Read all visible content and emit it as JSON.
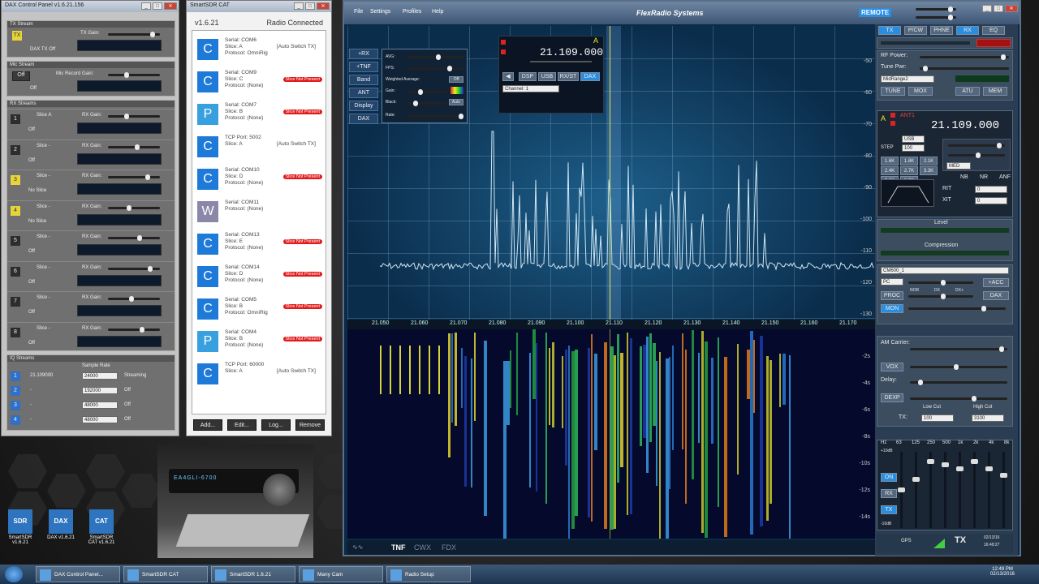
{
  "dax": {
    "title": "DAX Control Panel v1.6.21.156",
    "tx_stream": {
      "header": "TX Stream",
      "gain_label": "TX Gain:",
      "status": "DAX TX Off"
    },
    "mic_stream": {
      "header": "Mic Stream",
      "button": "Off",
      "gain_label": "Mic Record Gain:",
      "status": "Off"
    },
    "rx_header": "RX Streams",
    "rx": [
      {
        "num": "1",
        "slice": "Slice A",
        "status": "Off",
        "gain": "RX Gain:",
        "on": false
      },
      {
        "num": "2",
        "slice": "Slice -",
        "status": "Off",
        "gain": "RX Gain:",
        "on": false
      },
      {
        "num": "3",
        "slice": "Slice -",
        "status": "No Slice",
        "gain": "RX Gain:",
        "on": true
      },
      {
        "num": "4",
        "slice": "Slice -",
        "status": "No Slice",
        "gain": "RX Gain:",
        "on": true
      },
      {
        "num": "5",
        "slice": "Slice -",
        "status": "Off",
        "gain": "RX Gain:",
        "on": false
      },
      {
        "num": "6",
        "slice": "Slice -",
        "status": "Off",
        "gain": "RX Gain:",
        "on": false
      },
      {
        "num": "7",
        "slice": "Slice -",
        "status": "Off",
        "gain": "RX Gain:",
        "on": false
      },
      {
        "num": "8",
        "slice": "Slice -",
        "status": "Off",
        "gain": "RX Gain:",
        "on": false
      }
    ],
    "iq": {
      "header": "IQ Streams",
      "rate_label": "Sample Rate",
      "rows": [
        {
          "num": "1",
          "freq": "21.109000",
          "rate": "24000",
          "status": "Streaming"
        },
        {
          "num": "2",
          "freq": "-",
          "rate": "192000",
          "status": "Off"
        },
        {
          "num": "3",
          "freq": "-",
          "rate": "48000",
          "status": "Off"
        },
        {
          "num": "4",
          "freq": "-",
          "rate": "48000",
          "status": "Off"
        }
      ]
    }
  },
  "cat": {
    "title": "SmartSDR CAT",
    "version": "v1.6.21",
    "status": "Radio Connected",
    "items": [
      {
        "icon": "C",
        "name": "Serial: COM6",
        "slice": "Slice: A",
        "mode": "[Auto Switch TX]",
        "proto": "Protocol: OmniRig",
        "badge": ""
      },
      {
        "icon": "C",
        "name": "Serial: COM9",
        "slice": "Slice: C",
        "mode": "",
        "proto": "Protocol: (None)",
        "badge": "Slice Not Present"
      },
      {
        "icon": "P",
        "name": "Serial: COM7",
        "slice": "Slice: B",
        "mode": "",
        "proto": "Protocol: (None)",
        "badge": "Slice Not Present"
      },
      {
        "icon": "C",
        "name": "TCP Port: 5002",
        "slice": "Slice: A",
        "mode": "[Auto Switch TX]",
        "proto": "",
        "badge": ""
      },
      {
        "icon": "C",
        "name": "Serial: COM10",
        "slice": "Slice: D",
        "mode": "",
        "proto": "Protocol: (None)",
        "badge": "Slice Not Present"
      },
      {
        "icon": "W",
        "name": "Serial: COM11",
        "slice": "",
        "mode": "",
        "proto": "Protocol: (None)",
        "badge": ""
      },
      {
        "icon": "C",
        "name": "Serial: COM13",
        "slice": "Slice: E",
        "mode": "",
        "proto": "Protocol: (None)",
        "badge": "Slice Not Present"
      },
      {
        "icon": "C",
        "name": "Serial: COM14",
        "slice": "Slice: D",
        "mode": "",
        "proto": "Protocol: (None)",
        "badge": "Slice Not Present"
      },
      {
        "icon": "C",
        "name": "Serial: COM5",
        "slice": "Slice: B",
        "mode": "",
        "proto": "Protocol: OmniRig",
        "badge": "Slice Not Present"
      },
      {
        "icon": "P",
        "name": "Serial: COM4",
        "slice": "Slice: B",
        "mode": "",
        "proto": "Protocol: (None)",
        "badge": "Slice Not Present"
      },
      {
        "icon": "C",
        "name": "TCP Port: 60000",
        "slice": "Slice: A",
        "mode": "[Auto Switch TX]",
        "proto": "",
        "badge": ""
      }
    ],
    "buttons": [
      "Add...",
      "Edit...",
      "Log...",
      "Remove"
    ]
  },
  "sdr": {
    "menu": [
      "File",
      "Settings",
      "Profiles",
      "Help"
    ],
    "brand": "FlexRadio Systems",
    "remote": "REMOTE",
    "tabs": [
      "TX",
      "P/CW",
      "PHNE",
      "RX",
      "EQ"
    ],
    "left_buttons": [
      "+RX",
      "+TNF",
      "Band",
      "ANT",
      "Display",
      "DAX"
    ],
    "display_menu": [
      "AVG:",
      "FPS:",
      "Weighted Average:",
      "Color:",
      "Gain:",
      "Black:",
      "Rate:"
    ],
    "weighted_off": "Off",
    "black_auto": "Auto",
    "slice_freq": "21.109.000",
    "slice_letter": "A",
    "slice_tabs": [
      "DSP",
      "USB",
      "RX/ST",
      "DAX"
    ],
    "channel": "Channel: 1",
    "db_labels": [
      "-50",
      "-60",
      "-70",
      "-80",
      "-90",
      "-100",
      "-110",
      "-120",
      "-130"
    ],
    "freq_labels": [
      "21.050",
      "21.060",
      "21.070",
      "21.080",
      "21.090",
      "21.100",
      "21.110",
      "21.120",
      "21.130",
      "21.140",
      "21.150",
      "21.160",
      "21.170"
    ],
    "wf_times": [
      "-2s",
      "-4s",
      "-6s",
      "-8s",
      "-10s",
      "-12s",
      "-14s"
    ],
    "bottom": [
      "TNF",
      "CWX",
      "FDX"
    ],
    "right": {
      "rf_power": "RF Power:",
      "tune_pwr": "Tune Pwr:",
      "profile": "MidRange2",
      "tune": "TUNE",
      "mox": "MOX",
      "atu": "ATU",
      "mem": "MEM",
      "freq": "21.109.000",
      "ant": "ANT1",
      "mode": "USB",
      "step": "STEP",
      "step_val": "100",
      "filters": [
        "1.6K",
        "1.8K",
        "2.1K",
        "2.4K",
        "2.7K",
        "3.3K",
        "3.6K",
        "6.0K"
      ],
      "agc": "MED",
      "nb": "NB",
      "nr": "NR",
      "anf": "ANF",
      "rit": "RIT",
      "xit": "XIT",
      "level": "Level",
      "compression": "Compression",
      "mic_profile": "CM600_1",
      "mic": "PC",
      "acc": "+ACC",
      "proc": "PROC",
      "dax": "DAX",
      "nor": "NOR",
      "dx": "DX",
      "dxx": "DX+",
      "mon": "MON",
      "am_carrier": "AM Carrier:",
      "vox": "VOX",
      "delay": "Delay:",
      "dexp": "DEXP",
      "low_cut": "Low Cut",
      "high_cut": "High Cut",
      "tx_label": "TX:",
      "low_val": "100",
      "high_val": "3100",
      "eq_bands": [
        "Hz",
        "63",
        "125",
        "250",
        "500",
        "1k",
        "2k",
        "4k",
        "8k"
      ],
      "eq_on": "ON",
      "eq_rx": "RX",
      "eq_tx": "TX",
      "eq_plus": "+10dB",
      "eq_minus": "-10dB",
      "gps": "GPS",
      "tx_big": "TX",
      "date": "02/13/16",
      "time": "16:49:27"
    }
  },
  "desktop": {
    "icons": [
      {
        "label": "SmartSDR v1.6.21",
        "glyph": "SDR"
      },
      {
        "label": "DAX v1.6.21",
        "glyph": "DAX"
      },
      {
        "label": "SmartSDR CAT v1.6.21",
        "glyph": "CAT"
      }
    ],
    "radio_display": "EA4GLI-6700"
  },
  "taskbar": {
    "items": [
      "DAX Control Panel...",
      "SmartSDR CAT",
      "SmartSDR 1.6.21",
      "Many Cam",
      "Radio Setup"
    ],
    "time": "12:49 PM",
    "date": "02/13/2016"
  }
}
